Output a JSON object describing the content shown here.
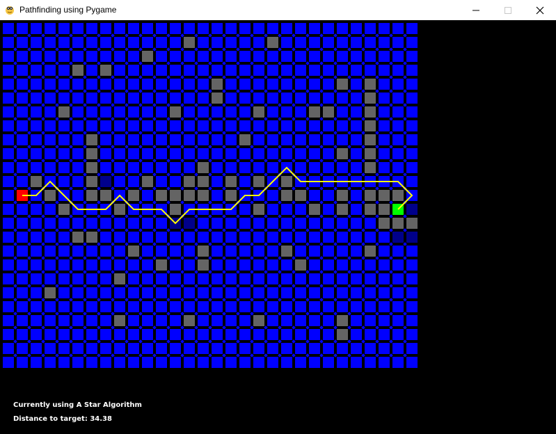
{
  "window": {
    "title": "Pathfinding using Pygame",
    "icon": "python-snake-icon",
    "buttons": [
      "minimize",
      "maximize",
      "close"
    ]
  },
  "grid": {
    "cols": 30,
    "rows": 25,
    "colors": {
      "open": "#0000ff",
      "open_dark": "#00008b",
      "gap": "#000000",
      "wall": "#646464",
      "start": "#ff0000",
      "end": "#00ff00",
      "path": "#ffff00"
    },
    "walls": [
      [
        13,
        1
      ],
      [
        19,
        1
      ],
      [
        10,
        2
      ],
      [
        5,
        3
      ],
      [
        7,
        3
      ],
      [
        15,
        4
      ],
      [
        24,
        4
      ],
      [
        26,
        4
      ],
      [
        15,
        5
      ],
      [
        26,
        5
      ],
      [
        4,
        6
      ],
      [
        12,
        6
      ],
      [
        18,
        6
      ],
      [
        22,
        6
      ],
      [
        23,
        6
      ],
      [
        26,
        6
      ],
      [
        26,
        7
      ],
      [
        6,
        8
      ],
      [
        17,
        8
      ],
      [
        26,
        8
      ],
      [
        6,
        9
      ],
      [
        24,
        9
      ],
      [
        26,
        9
      ],
      [
        6,
        10
      ],
      [
        14,
        10
      ],
      [
        26,
        10
      ],
      [
        2,
        11
      ],
      [
        6,
        11
      ],
      [
        10,
        11
      ],
      [
        13,
        11
      ],
      [
        14,
        11
      ],
      [
        16,
        11
      ],
      [
        18,
        11
      ],
      [
        20,
        11
      ],
      [
        3,
        12
      ],
      [
        6,
        12
      ],
      [
        7,
        12
      ],
      [
        9,
        12
      ],
      [
        11,
        12
      ],
      [
        12,
        12
      ],
      [
        13,
        12
      ],
      [
        14,
        12
      ],
      [
        16,
        12
      ],
      [
        20,
        12
      ],
      [
        21,
        12
      ],
      [
        24,
        12
      ],
      [
        26,
        12
      ],
      [
        27,
        12
      ],
      [
        28,
        12
      ],
      [
        4,
        13
      ],
      [
        8,
        13
      ],
      [
        12,
        13
      ],
      [
        18,
        13
      ],
      [
        22,
        13
      ],
      [
        24,
        13
      ],
      [
        26,
        13
      ],
      [
        27,
        13
      ],
      [
        27,
        14
      ],
      [
        28,
        14
      ],
      [
        29,
        14
      ],
      [
        5,
        15
      ],
      [
        6,
        15
      ],
      [
        9,
        16
      ],
      [
        14,
        16
      ],
      [
        20,
        16
      ],
      [
        26,
        16
      ],
      [
        11,
        17
      ],
      [
        14,
        17
      ],
      [
        21,
        17
      ],
      [
        8,
        18
      ],
      [
        3,
        19
      ],
      [
        8,
        21
      ],
      [
        13,
        21
      ],
      [
        18,
        21
      ],
      [
        24,
        21
      ],
      [
        24,
        22
      ]
    ],
    "visited": [
      [
        7,
        11
      ],
      [
        12,
        14
      ],
      [
        13,
        14
      ],
      [
        28,
        13
      ],
      [
        29,
        13
      ],
      [
        28,
        15
      ],
      [
        29,
        15
      ]
    ],
    "start": [
      1,
      12
    ],
    "end": [
      28,
      13
    ],
    "path": [
      [
        1,
        12
      ],
      [
        2,
        12
      ],
      [
        3,
        11
      ],
      [
        4,
        12
      ],
      [
        5,
        13
      ],
      [
        6,
        13
      ],
      [
        7,
        13
      ],
      [
        8,
        12
      ],
      [
        9,
        13
      ],
      [
        10,
        13
      ],
      [
        11,
        13
      ],
      [
        12,
        14
      ],
      [
        13,
        13
      ],
      [
        14,
        13
      ],
      [
        15,
        13
      ],
      [
        16,
        13
      ],
      [
        17,
        12
      ],
      [
        18,
        12
      ],
      [
        19,
        11
      ],
      [
        20,
        10
      ],
      [
        21,
        11
      ],
      [
        22,
        11
      ],
      [
        23,
        11
      ],
      [
        24,
        11
      ],
      [
        25,
        11
      ],
      [
        26,
        11
      ],
      [
        27,
        11
      ],
      [
        28,
        11
      ],
      [
        29,
        12
      ],
      [
        28,
        13
      ]
    ]
  },
  "status": {
    "algorithm": "Currently using A Star Algorithm",
    "distance": "Distance to target: 34.38"
  }
}
